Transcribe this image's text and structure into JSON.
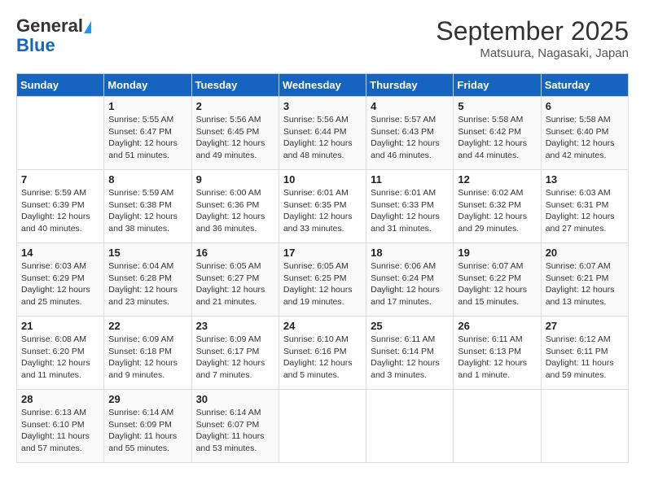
{
  "header": {
    "logo_general": "General",
    "logo_blue": "Blue",
    "month_title": "September 2025",
    "location": "Matsuura, Nagasaki, Japan"
  },
  "days_of_week": [
    "Sunday",
    "Monday",
    "Tuesday",
    "Wednesday",
    "Thursday",
    "Friday",
    "Saturday"
  ],
  "weeks": [
    [
      {
        "day": "",
        "info": ""
      },
      {
        "day": "1",
        "info": "Sunrise: 5:55 AM\nSunset: 6:47 PM\nDaylight: 12 hours\nand 51 minutes."
      },
      {
        "day": "2",
        "info": "Sunrise: 5:56 AM\nSunset: 6:45 PM\nDaylight: 12 hours\nand 49 minutes."
      },
      {
        "day": "3",
        "info": "Sunrise: 5:56 AM\nSunset: 6:44 PM\nDaylight: 12 hours\nand 48 minutes."
      },
      {
        "day": "4",
        "info": "Sunrise: 5:57 AM\nSunset: 6:43 PM\nDaylight: 12 hours\nand 46 minutes."
      },
      {
        "day": "5",
        "info": "Sunrise: 5:58 AM\nSunset: 6:42 PM\nDaylight: 12 hours\nand 44 minutes."
      },
      {
        "day": "6",
        "info": "Sunrise: 5:58 AM\nSunset: 6:40 PM\nDaylight: 12 hours\nand 42 minutes."
      }
    ],
    [
      {
        "day": "7",
        "info": "Sunrise: 5:59 AM\nSunset: 6:39 PM\nDaylight: 12 hours\nand 40 minutes."
      },
      {
        "day": "8",
        "info": "Sunrise: 5:59 AM\nSunset: 6:38 PM\nDaylight: 12 hours\nand 38 minutes."
      },
      {
        "day": "9",
        "info": "Sunrise: 6:00 AM\nSunset: 6:36 PM\nDaylight: 12 hours\nand 36 minutes."
      },
      {
        "day": "10",
        "info": "Sunrise: 6:01 AM\nSunset: 6:35 PM\nDaylight: 12 hours\nand 33 minutes."
      },
      {
        "day": "11",
        "info": "Sunrise: 6:01 AM\nSunset: 6:33 PM\nDaylight: 12 hours\nand 31 minutes."
      },
      {
        "day": "12",
        "info": "Sunrise: 6:02 AM\nSunset: 6:32 PM\nDaylight: 12 hours\nand 29 minutes."
      },
      {
        "day": "13",
        "info": "Sunrise: 6:03 AM\nSunset: 6:31 PM\nDaylight: 12 hours\nand 27 minutes."
      }
    ],
    [
      {
        "day": "14",
        "info": "Sunrise: 6:03 AM\nSunset: 6:29 PM\nDaylight: 12 hours\nand 25 minutes."
      },
      {
        "day": "15",
        "info": "Sunrise: 6:04 AM\nSunset: 6:28 PM\nDaylight: 12 hours\nand 23 minutes."
      },
      {
        "day": "16",
        "info": "Sunrise: 6:05 AM\nSunset: 6:27 PM\nDaylight: 12 hours\nand 21 minutes."
      },
      {
        "day": "17",
        "info": "Sunrise: 6:05 AM\nSunset: 6:25 PM\nDaylight: 12 hours\nand 19 minutes."
      },
      {
        "day": "18",
        "info": "Sunrise: 6:06 AM\nSunset: 6:24 PM\nDaylight: 12 hours\nand 17 minutes."
      },
      {
        "day": "19",
        "info": "Sunrise: 6:07 AM\nSunset: 6:22 PM\nDaylight: 12 hours\nand 15 minutes."
      },
      {
        "day": "20",
        "info": "Sunrise: 6:07 AM\nSunset: 6:21 PM\nDaylight: 12 hours\nand 13 minutes."
      }
    ],
    [
      {
        "day": "21",
        "info": "Sunrise: 6:08 AM\nSunset: 6:20 PM\nDaylight: 12 hours\nand 11 minutes."
      },
      {
        "day": "22",
        "info": "Sunrise: 6:09 AM\nSunset: 6:18 PM\nDaylight: 12 hours\nand 9 minutes."
      },
      {
        "day": "23",
        "info": "Sunrise: 6:09 AM\nSunset: 6:17 PM\nDaylight: 12 hours\nand 7 minutes."
      },
      {
        "day": "24",
        "info": "Sunrise: 6:10 AM\nSunset: 6:16 PM\nDaylight: 12 hours\nand 5 minutes."
      },
      {
        "day": "25",
        "info": "Sunrise: 6:11 AM\nSunset: 6:14 PM\nDaylight: 12 hours\nand 3 minutes."
      },
      {
        "day": "26",
        "info": "Sunrise: 6:11 AM\nSunset: 6:13 PM\nDaylight: 12 hours\nand 1 minute."
      },
      {
        "day": "27",
        "info": "Sunrise: 6:12 AM\nSunset: 6:11 PM\nDaylight: 11 hours\nand 59 minutes."
      }
    ],
    [
      {
        "day": "28",
        "info": "Sunrise: 6:13 AM\nSunset: 6:10 PM\nDaylight: 11 hours\nand 57 minutes."
      },
      {
        "day": "29",
        "info": "Sunrise: 6:14 AM\nSunset: 6:09 PM\nDaylight: 11 hours\nand 55 minutes."
      },
      {
        "day": "30",
        "info": "Sunrise: 6:14 AM\nSunset: 6:07 PM\nDaylight: 11 hours\nand 53 minutes."
      },
      {
        "day": "",
        "info": ""
      },
      {
        "day": "",
        "info": ""
      },
      {
        "day": "",
        "info": ""
      },
      {
        "day": "",
        "info": ""
      }
    ]
  ]
}
